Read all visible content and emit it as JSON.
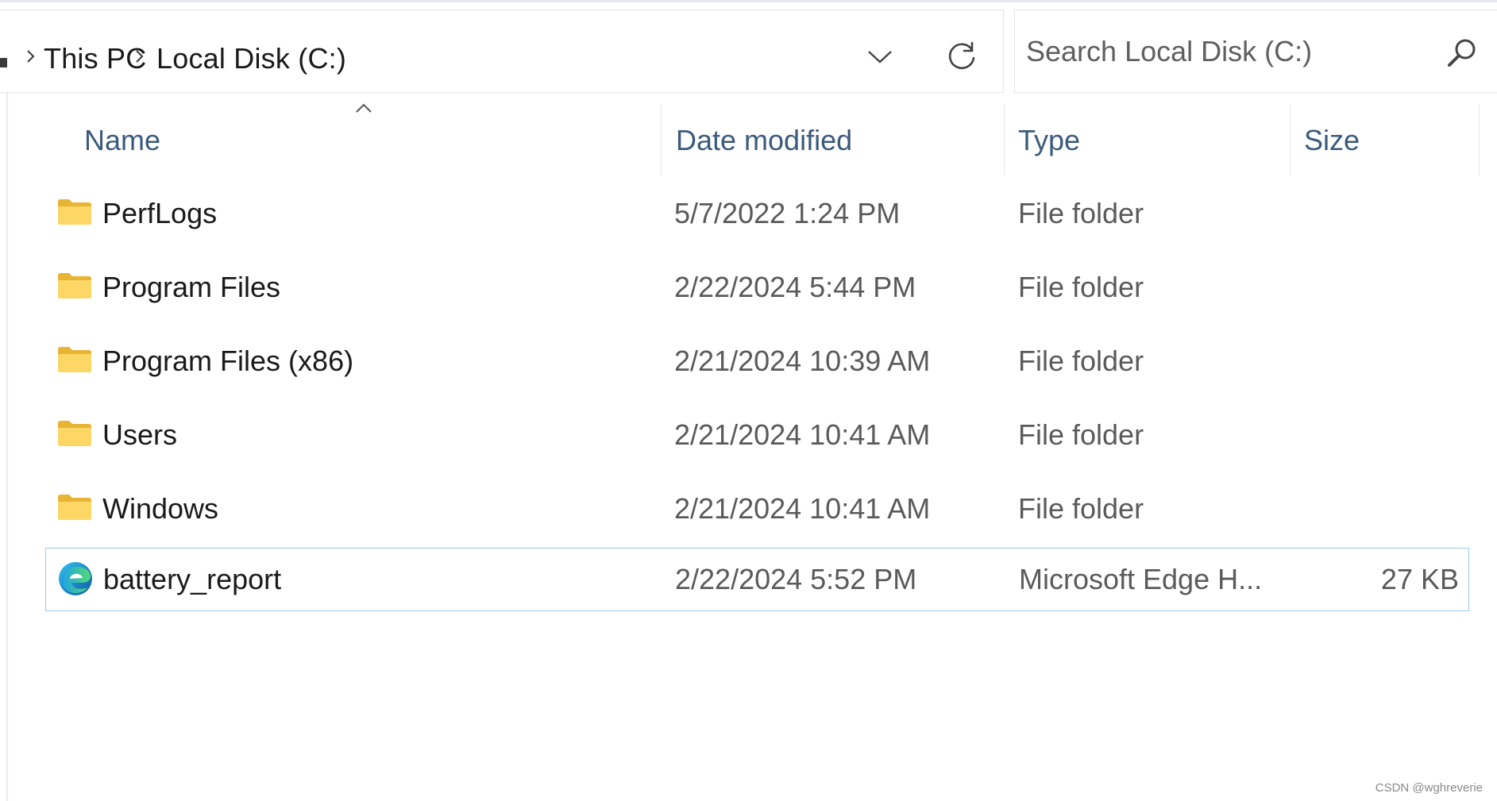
{
  "address_bar": {
    "breadcrumbs": [
      "This PC",
      "Local Disk (C:)"
    ]
  },
  "search": {
    "placeholder": "Search Local Disk (C:)"
  },
  "columns": {
    "name": "Name",
    "date_modified": "Date modified",
    "type": "Type",
    "size": "Size",
    "sort_column": "name",
    "sort_direction": "ascending"
  },
  "files": [
    {
      "name": "PerfLogs",
      "date": "5/7/2022 1:24 PM",
      "type": "File folder",
      "size": "",
      "icon": "folder-icon"
    },
    {
      "name": "Program Files",
      "date": "2/22/2024 5:44 PM",
      "type": "File folder",
      "size": "",
      "icon": "folder-icon"
    },
    {
      "name": "Program Files (x86)",
      "date": "2/21/2024 10:39 AM",
      "type": "File folder",
      "size": "",
      "icon": "folder-icon"
    },
    {
      "name": "Users",
      "date": "2/21/2024 10:41 AM",
      "type": "File folder",
      "size": "",
      "icon": "folder-icon"
    },
    {
      "name": "Windows",
      "date": "2/21/2024 10:41 AM",
      "type": "File folder",
      "size": "",
      "icon": "folder-icon"
    },
    {
      "name": "battery_report",
      "date": "2/22/2024 5:52 PM",
      "type": "Microsoft Edge H...",
      "size": "27 KB",
      "icon": "edge-icon",
      "selected": true
    }
  ],
  "watermark": "CSDN @wghreverie",
  "colors": {
    "header_text": "#3c5a7a",
    "selection_border": "#9ccbea",
    "folder_yellow": "#f7c948"
  }
}
